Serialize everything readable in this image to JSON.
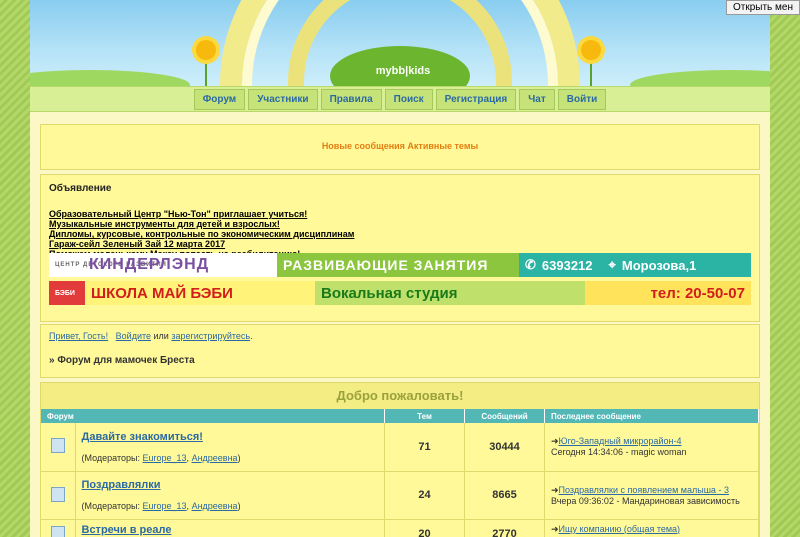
{
  "system": {
    "open_menu_label": "Открыть мен"
  },
  "header": {
    "logo_text": "mybb|kids"
  },
  "nav": [
    "Форум",
    "Участники",
    "Правила",
    "Поиск",
    "Регистрация",
    "Чат",
    "Войти"
  ],
  "new_posts": "Новые сообщения Активные темы",
  "announcement": {
    "title": "Объявление",
    "lines": [
      "Образовательный Центр \"Нью-Тон\" приглашает учиться!",
      "Музыкальные инструменты для детей и взрослых!",
      "Дипломы, курсовые, контрольные по экономическим дисциплинам",
      "Гараж-сейл Зеленый Зай 12 марта 2017",
      "Поможем маленькому Максу попасть на реабилитацию!"
    ],
    "banner1": {
      "brand": "КИНДЕРЛЭНД",
      "brand_sub": "ЦЕНТР ДЕТСКОГО РАЗВИТИЯ",
      "activity": "РАЗВИВАЮЩИЕ ЗАНЯТИЯ",
      "phone": "6393212",
      "address": "Морозова,1"
    },
    "banner2": {
      "logo": "БЭБИ",
      "school": "ШКОЛА МАЙ БЭБИ",
      "studio": "Вокальная студия",
      "phone": "тел: 20-50-07"
    }
  },
  "welcome": {
    "greeting": "Привет, Гость!",
    "login": "Войдите",
    "or": "или",
    "register": "зарегистрируйтесь",
    "breadcrumb": "» Форум для мамочек Бреста"
  },
  "forum": {
    "title": "Добро пожаловать!",
    "columns": [
      "Форум",
      "Тем",
      "Сообщений",
      "Последнее сообщение"
    ],
    "moderators_label": "(Модераторы:",
    "rows": [
      {
        "name": "Давайте знакомиться!",
        "mod1": "Europe_13",
        "mod2": "Андреевна",
        "topics": "71",
        "posts": "30444",
        "last_topic": "Юго-Западный микрорайон-4",
        "last_info": "Сегодня 14:34:06 - magic woman"
      },
      {
        "name": "Поздравлялки",
        "mod1": "Europe_13",
        "mod2": "Андреевна",
        "topics": "24",
        "posts": "8665",
        "last_topic": "Поздравлялки с появлением малыша - 3",
        "last_info": "Вчера 09:36:02 - Мандариновая зависимость"
      },
      {
        "name": "Встречи в реале",
        "topics": "20",
        "posts": "2770",
        "last_topic": "Ищу компанию (общая тема)"
      }
    ]
  }
}
